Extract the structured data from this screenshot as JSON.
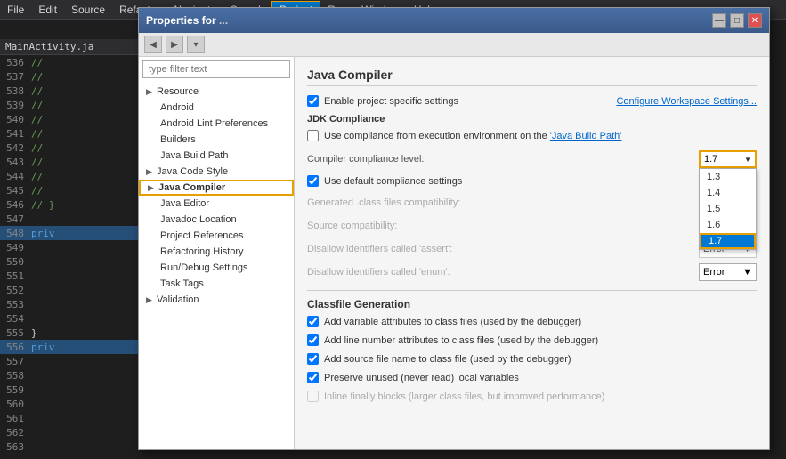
{
  "menubar": {
    "items": [
      "File",
      "Edit",
      "Source",
      "Refactor",
      "Navigate",
      "Search",
      "Project",
      "Run",
      "Window",
      "Help"
    ],
    "active_item": "Project"
  },
  "editor": {
    "tab": "MainActivity.java",
    "lines": [
      {
        "num": "536",
        "content": "//",
        "type": "comment"
      },
      {
        "num": "537",
        "content": "//",
        "type": "comment"
      },
      {
        "num": "538",
        "content": "//",
        "type": "comment"
      },
      {
        "num": "539",
        "content": "//",
        "type": "comment"
      },
      {
        "num": "540",
        "content": "//",
        "type": "comment"
      },
      {
        "num": "541",
        "content": "//",
        "type": "comment"
      },
      {
        "num": "542",
        "content": "//",
        "type": "comment"
      },
      {
        "num": "543",
        "content": "//",
        "type": "comment"
      },
      {
        "num": "544",
        "content": "//",
        "type": "comment"
      },
      {
        "num": "545",
        "content": "//",
        "type": "comment"
      },
      {
        "num": "546",
        "content": "// }",
        "type": "comment"
      },
      {
        "num": "547",
        "content": "",
        "type": "blank"
      },
      {
        "num": "548",
        "content": "priv",
        "type": "keyword"
      },
      {
        "num": "549",
        "content": "",
        "type": "blank"
      },
      {
        "num": "550",
        "content": "",
        "type": "blank"
      },
      {
        "num": "551",
        "content": "",
        "type": "blank"
      },
      {
        "num": "552",
        "content": "",
        "type": "blank"
      },
      {
        "num": "553",
        "content": "",
        "type": "blank"
      },
      {
        "num": "554",
        "content": "",
        "type": "blank"
      },
      {
        "num": "555",
        "content": "}",
        "type": "code"
      },
      {
        "num": "556",
        "content": "priv",
        "type": "keyword"
      },
      {
        "num": "557",
        "content": "",
        "type": "blank"
      },
      {
        "num": "558",
        "content": "",
        "type": "blank"
      },
      {
        "num": "559",
        "content": "",
        "type": "blank"
      },
      {
        "num": "560",
        "content": "",
        "type": "blank"
      },
      {
        "num": "561",
        "content": "",
        "type": "blank"
      },
      {
        "num": "562",
        "content": "",
        "type": "blank"
      },
      {
        "num": "563",
        "content": "",
        "type": "blank"
      }
    ]
  },
  "dialog": {
    "title": "Properties for",
    "title_project": "...",
    "nav_back_label": "◀",
    "nav_forward_label": "▶",
    "nav_menu_label": "▾"
  },
  "filter": {
    "placeholder": "type filter text"
  },
  "tree": {
    "items": [
      {
        "label": "Resource",
        "indent": 1,
        "has_arrow": true,
        "arrow": "▶",
        "selected": false
      },
      {
        "label": "Android",
        "indent": 2,
        "has_arrow": false,
        "selected": false
      },
      {
        "label": "Android Lint Preferences",
        "indent": 2,
        "has_arrow": false,
        "selected": false
      },
      {
        "label": "Builders",
        "indent": 2,
        "has_arrow": false,
        "selected": false
      },
      {
        "label": "Java Build Path",
        "indent": 2,
        "has_arrow": false,
        "selected": false
      },
      {
        "label": "Java Code Style",
        "indent": 1,
        "has_arrow": true,
        "arrow": "▶",
        "selected": false
      },
      {
        "label": "Java Compiler",
        "indent": 1,
        "has_arrow": true,
        "arrow": "▶",
        "selected": true
      },
      {
        "label": "Java Editor",
        "indent": 2,
        "has_arrow": false,
        "selected": false
      },
      {
        "label": "Javadoc Location",
        "indent": 2,
        "has_arrow": false,
        "selected": false
      },
      {
        "label": "Project References",
        "indent": 2,
        "has_arrow": false,
        "selected": false
      },
      {
        "label": "Refactoring History",
        "indent": 2,
        "has_arrow": false,
        "selected": false
      },
      {
        "label": "Run/Debug Settings",
        "indent": 2,
        "has_arrow": false,
        "selected": false
      },
      {
        "label": "Task Tags",
        "indent": 2,
        "has_arrow": false,
        "selected": false
      },
      {
        "label": "Validation",
        "indent": 1,
        "has_arrow": true,
        "arrow": "▶",
        "selected": false
      }
    ]
  },
  "right_panel": {
    "title": "Java Compiler",
    "enable_checkbox_label": "Enable project specific settings",
    "configure_link": "Configure Workspace Settings...",
    "jdk_compliance_title": "JDK Compliance",
    "use_compliance_label": "Use compliance from execution environment on the",
    "java_build_path_link": "'Java Build Path'",
    "compiler_level_label": "Compiler compliance level:",
    "selected_level": "1.7",
    "use_default_checkbox_label": "Use default compliance settings",
    "generated_class_label": "Generated .class files compatibility:",
    "source_compat_label": "Source compatibility:",
    "disallow_assert_label": "Disallow identifiers called 'assert':",
    "disallow_enum_label": "Disallow identifiers called 'enum':",
    "disallow_assert_value": "Error",
    "disallow_enum_value": "Error",
    "dropdown_options": [
      "1.3",
      "1.4",
      "1.5",
      "1.6",
      "1.7"
    ],
    "classfile_title": "Classfile Generation",
    "classfile_items": [
      "Add variable attributes to class files (used by the debugger)",
      "Add line number attributes to class files (used by the debugger)",
      "Add source file name to class file (used by the debugger)",
      "Preserve unused (never read) local variables",
      "Inline finally blocks (larger class files, but improved performance)"
    ],
    "classfile_checked": [
      true,
      true,
      true,
      true,
      false
    ]
  },
  "titlebar_buttons": {
    "minimize": "—",
    "maximize": "□",
    "close": "✕"
  }
}
